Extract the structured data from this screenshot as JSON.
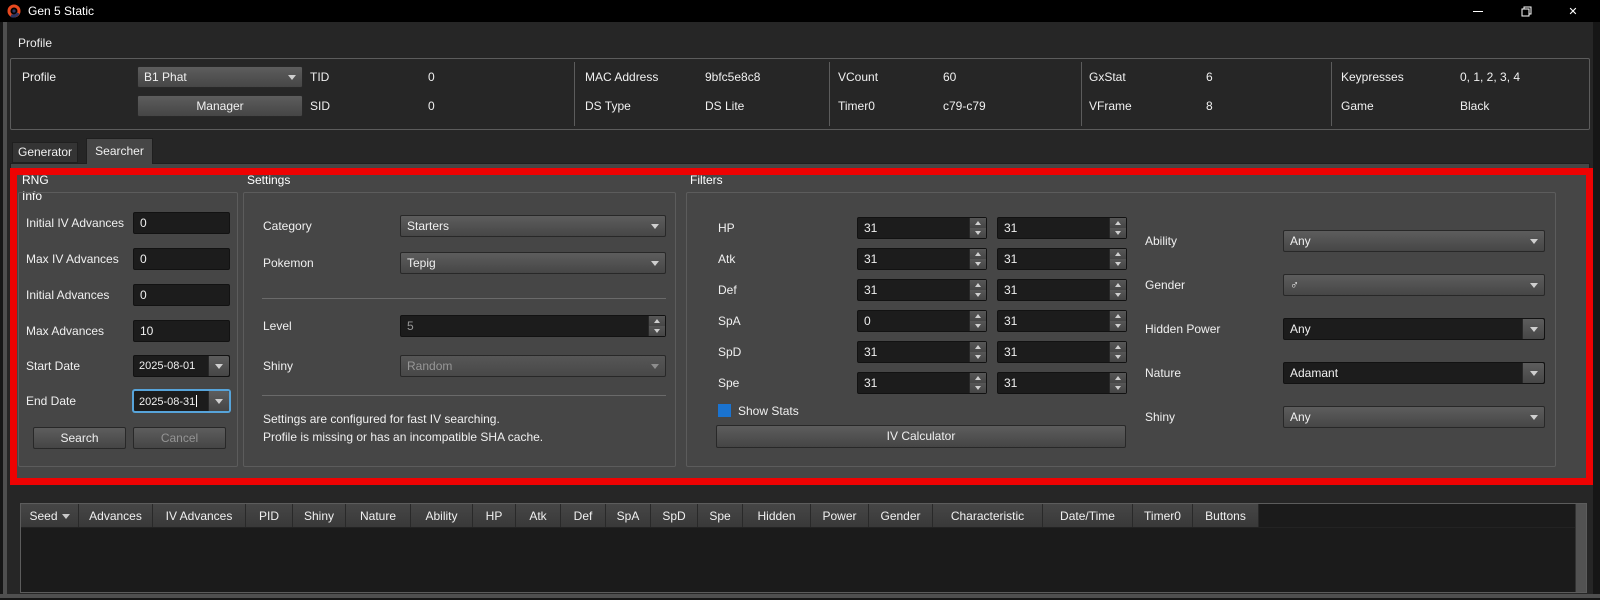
{
  "window": {
    "title": "Gen 5 Static",
    "close_glyph": "✕"
  },
  "menu": {
    "profile": "Profile"
  },
  "profile_panel": {
    "label": "Profile",
    "selected_profile": "B1 Phat",
    "manager_button": "Manager",
    "info": [
      {
        "label": "TID",
        "value": "0"
      },
      {
        "label": "SID",
        "value": "0"
      },
      {
        "label": "MAC Address",
        "value": "9bfc5e8c8"
      },
      {
        "label": "DS Type",
        "value": "DS Lite"
      },
      {
        "label": "VCount",
        "value": "60"
      },
      {
        "label": "Timer0",
        "value": "c79-c79"
      },
      {
        "label": "GxStat",
        "value": "6"
      },
      {
        "label": "VFrame",
        "value": "8"
      },
      {
        "label": "Keypresses",
        "value": "0, 1, 2, 3, 4"
      },
      {
        "label": "Game",
        "value": "Black"
      }
    ]
  },
  "tabs": {
    "generator": "Generator",
    "searcher": "Searcher",
    "active": "Searcher"
  },
  "rng_info": {
    "title": "RNG Info",
    "fields": [
      {
        "label": "Initial IV Advances",
        "value": "0"
      },
      {
        "label": "Max IV Advances",
        "value": "0"
      },
      {
        "label": "Initial Advances",
        "value": "0"
      },
      {
        "label": "Max Advances",
        "value": "10"
      }
    ],
    "start_date": {
      "label": "Start Date",
      "value": "2025-08-01"
    },
    "end_date": {
      "label": "End Date",
      "value": "2025-08-31",
      "focused": true
    },
    "search_button": "Search",
    "cancel_button": "Cancel"
  },
  "settings": {
    "title": "Settings",
    "category": {
      "label": "Category",
      "value": "Starters"
    },
    "pokemon": {
      "label": "Pokemon",
      "value": "Tepig"
    },
    "level": {
      "label": "Level",
      "value": "5",
      "disabled": true
    },
    "shiny": {
      "label": "Shiny",
      "value": "Random",
      "disabled": true
    },
    "notes": [
      "Settings are configured for fast IV searching.",
      "Profile is missing or has an incompatible SHA cache."
    ]
  },
  "filters": {
    "title": "Filters",
    "ivs": [
      {
        "label": "HP",
        "min": "31",
        "max": "31"
      },
      {
        "label": "Atk",
        "min": "31",
        "max": "31"
      },
      {
        "label": "Def",
        "min": "31",
        "max": "31"
      },
      {
        "label": "SpA",
        "min": "0",
        "max": "31"
      },
      {
        "label": "SpD",
        "min": "31",
        "max": "31"
      },
      {
        "label": "Spe",
        "min": "31",
        "max": "31"
      }
    ],
    "show_stats": {
      "label": "Show Stats",
      "checked": true,
      "check_color": "#1a73d0"
    },
    "iv_calculator_button": "IV Calculator",
    "dropdowns": [
      {
        "label": "Ability",
        "value": "Any",
        "style": "normal"
      },
      {
        "label": "Gender",
        "value": "♂",
        "style": "normal"
      },
      {
        "label": "Hidden Power",
        "value": "Any",
        "style": "dark"
      },
      {
        "label": "Nature",
        "value": "Adamant",
        "style": "dark"
      },
      {
        "label": "Shiny",
        "value": "Any",
        "style": "normal"
      }
    ]
  },
  "results_table": {
    "columns": [
      "Seed",
      "Advances",
      "IV Advances",
      "PID",
      "Shiny",
      "Nature",
      "Ability",
      "HP",
      "Atk",
      "Def",
      "SpA",
      "SpD",
      "Spe",
      "Hidden",
      "Power",
      "Gender",
      "Characteristic",
      "Date/Time",
      "Timer0",
      "Buttons"
    ],
    "sort_column": "Seed",
    "rows": []
  },
  "annotation": {
    "type": "highlight-rectangle",
    "color": "#ee0202"
  }
}
